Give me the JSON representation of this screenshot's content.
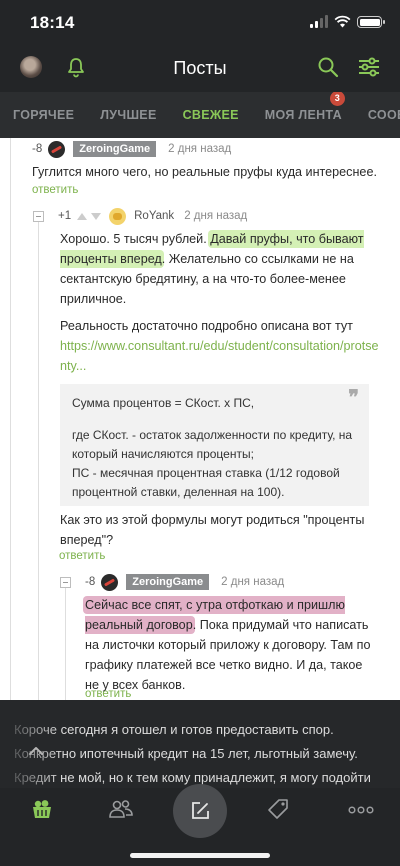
{
  "status_bar": {
    "time": "18:14",
    "battery_level": 1.0
  },
  "header": {
    "title": "Посты"
  },
  "tabs": [
    {
      "label": "ГОРЯЧЕЕ"
    },
    {
      "label": "ЛУЧШЕЕ"
    },
    {
      "label": "СВЕЖЕЕ",
      "active": true
    },
    {
      "label": "МОЯ ЛЕНТА",
      "badge": "3"
    },
    {
      "label": "СООБЩЕ"
    }
  ],
  "comments": [
    {
      "rating": "-8",
      "author": "ZeroingGame",
      "time": "2 дня назад",
      "text": "Гуглится много чего, но реальные пруфы куда интереснее.",
      "reply_label": "ответить"
    },
    {
      "rating": "+1",
      "author": "RoYank",
      "time": "2 дня назад",
      "p1_a": "Хорошо. 5 тысяч рублей. ",
      "p1_hl": "Давай пруфы, что бывают проценты вперед",
      "p1_b": ". Желательно со ссылками не на сектантскую бредятину, а на что-то более-менее приличное.",
      "p2": "Реальность достаточно подробно описана вот тут",
      "link": "https://www.consultant.ru/edu/student/consultation/protsenty...",
      "quote": {
        "line1": "Сумма процентов = СКост. х ПС,",
        "line2": "где СКост. - остаток задолженности по кредиту, на который начисляются проценты;",
        "line3": "ПС - месячная процентная ставка (1/12 годовой процентной ставки, деленная на 100)."
      },
      "p3": "Как это из этой формулы могут родиться \"проценты вперед\"?",
      "reply_label": "ответить"
    },
    {
      "rating": "-8",
      "author": "ZeroingGame",
      "time": "2 дня назад",
      "hl": "Сейчас все спят, с утра отфоткаю и пришлю реальный договор",
      "rest": ". Пока придумай что написать на листочки который приложу к договору. Там по графику платежей все четко видно. И да, такое не у всех банков.",
      "reply_label": "ответить"
    }
  ],
  "overlay": {
    "line1": "Короче сегодня я отошел и готов предоставить спор.",
    "line2": "Конкретно ипотечный кредит на 15 лет, льготный замечу.",
    "line3": "Кредит не мой, но к тем кому принадлежит, я могу подойти"
  },
  "colors": {
    "accent": "#8ac858",
    "link": "#7db24c",
    "badge": "#c94a3a",
    "highlight_green": "#b0e478",
    "highlight_pink": "#be5282"
  }
}
